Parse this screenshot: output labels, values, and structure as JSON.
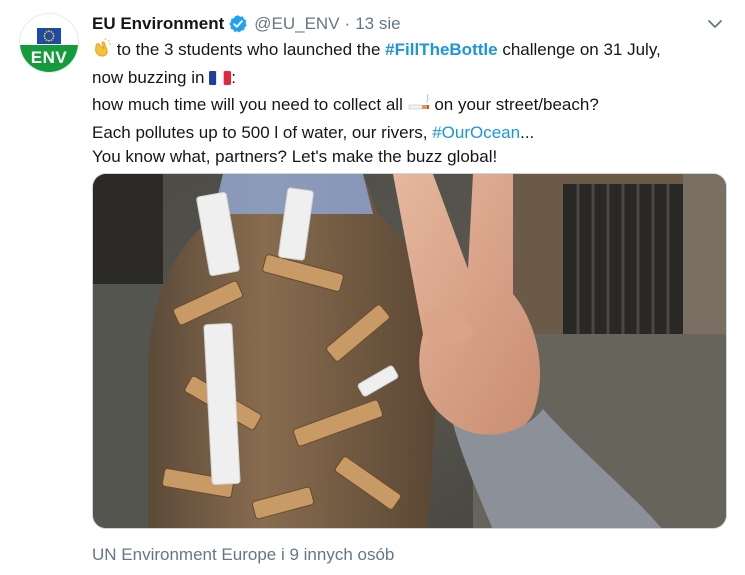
{
  "account": {
    "name": "EU Environment",
    "handle": "@EU_ENV",
    "separator": "·",
    "date": "13 sie",
    "avatar_text": "ENV"
  },
  "tweet": {
    "line1_text": "to the 3 students who launched the",
    "line1_hashtag": "#FillTheBottle",
    "line1_tail": "challenge on 31 July,",
    "line2_text": "now buzzing in",
    "line2_tail": ":",
    "line3_text": "how much time will you need to collect all",
    "line3_tail": "on your street/beach?",
    "line4_text": "Each pollutes up to 500 l of water, our rivers,",
    "line4_hashtag": "#OurOcean",
    "line4_tail": "...",
    "line5_text": "You know what, partners? Let's make the buzz global!"
  },
  "footer": {
    "liked_by": "UN Environment Europe i 9 innych osób"
  },
  "icons": {
    "clap": "clapping-hands-emoji",
    "flag": "france-flag-emoji",
    "cigarette": "cigarette-emoji",
    "verified": "verified-badge-icon",
    "chevron": "chevron-down-icon"
  },
  "colors": {
    "link": "#1b95e0",
    "secondary_text": "#657786",
    "avatar_green": "#149c3c",
    "eu_blue": "#1f4aa8"
  }
}
